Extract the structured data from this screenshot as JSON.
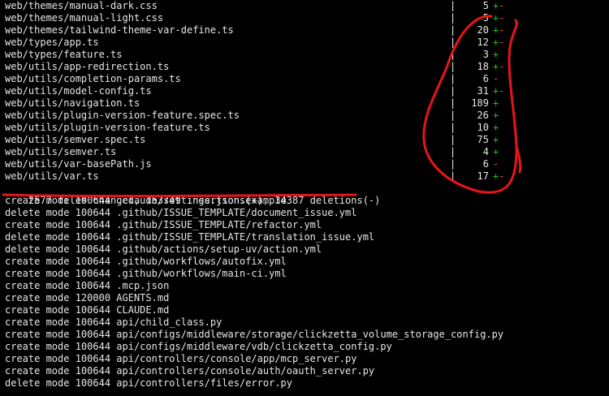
{
  "diffstat": [
    {
      "path": "web/themes/manual-dark.css",
      "sep": "|",
      "count": "5",
      "plus": "+",
      "minus": "-"
    },
    {
      "path": "web/themes/manual-light.css",
      "sep": "|",
      "count": "5",
      "plus": "+",
      "minus": "-"
    },
    {
      "path": "web/themes/tailwind-theme-var-define.ts",
      "sep": "|",
      "count": "20",
      "plus": "+",
      "minus": "-"
    },
    {
      "path": "web/types/app.ts",
      "sep": "|",
      "count": "12",
      "plus": "+",
      "minus": "-"
    },
    {
      "path": "web/types/feature.ts",
      "sep": "|",
      "count": "3",
      "plus": "+",
      "minus": ""
    },
    {
      "path": "web/utils/app-redirection.ts",
      "sep": "|",
      "count": "18",
      "plus": "+",
      "minus": "-"
    },
    {
      "path": "web/utils/completion-params.ts",
      "sep": "|",
      "count": "6",
      "plus": "",
      "minus": "-"
    },
    {
      "path": "web/utils/model-config.ts",
      "sep": "|",
      "count": "31",
      "plus": "+",
      "minus": "-"
    },
    {
      "path": "web/utils/navigation.ts",
      "sep": "|",
      "count": "189",
      "plus": "+",
      "minus": ""
    },
    {
      "path": "web/utils/plugin-version-feature.spec.ts",
      "sep": "|",
      "count": "26",
      "plus": "+",
      "minus": ""
    },
    {
      "path": "web/utils/plugin-version-feature.ts",
      "sep": "|",
      "count": "10",
      "plus": "+",
      "minus": ""
    },
    {
      "path": "web/utils/semver.spec.ts",
      "sep": "|",
      "count": "75",
      "plus": "+",
      "minus": ""
    },
    {
      "path": "web/utils/semver.ts",
      "sep": "|",
      "count": "4",
      "plus": "+",
      "minus": ""
    },
    {
      "path": "web/utils/var-basePath.js",
      "sep": "|",
      "count": "6",
      "plus": "",
      "minus": "-"
    },
    {
      "path": "web/utils/var.ts",
      "sep": "|",
      "count": "17",
      "plus": "+",
      "minus": "-"
    }
  ],
  "summary": "2577 files changed, 153749 insertions(+), 34387 deletions(-)",
  "mode_lines": [
    "create mode 100644 .claude/settings.json.example",
    "delete mode 100644 .github/ISSUE_TEMPLATE/document_issue.yml",
    "create mode 100644 .github/ISSUE_TEMPLATE/refactor.yml",
    "delete mode 100644 .github/ISSUE_TEMPLATE/translation_issue.yml",
    "delete mode 100644 .github/actions/setup-uv/action.yml",
    "create mode 100644 .github/workflows/autofix.yml",
    "create mode 100644 .github/workflows/main-ci.yml",
    "create mode 100644 .mcp.json",
    "create mode 120000 AGENTS.md",
    "create mode 100644 CLAUDE.md",
    "create mode 100644 api/child_class.py",
    "create mode 100644 api/configs/middleware/storage/clickzetta_volume_storage_config.py",
    "create mode 100644 api/configs/middleware/vdb/clickzetta_config.py",
    "create mode 100644 api/controllers/console/app/mcp_server.py",
    "create mode 100644 api/controllers/console/auth/oauth_server.py",
    "delete mode 100644 api/controllers/files/error.py"
  ],
  "colors": {
    "background": "#000000",
    "text": "#e6e6e6",
    "plus": "#16c60c",
    "minus": "#e74856",
    "annotation": "#e8141c"
  }
}
